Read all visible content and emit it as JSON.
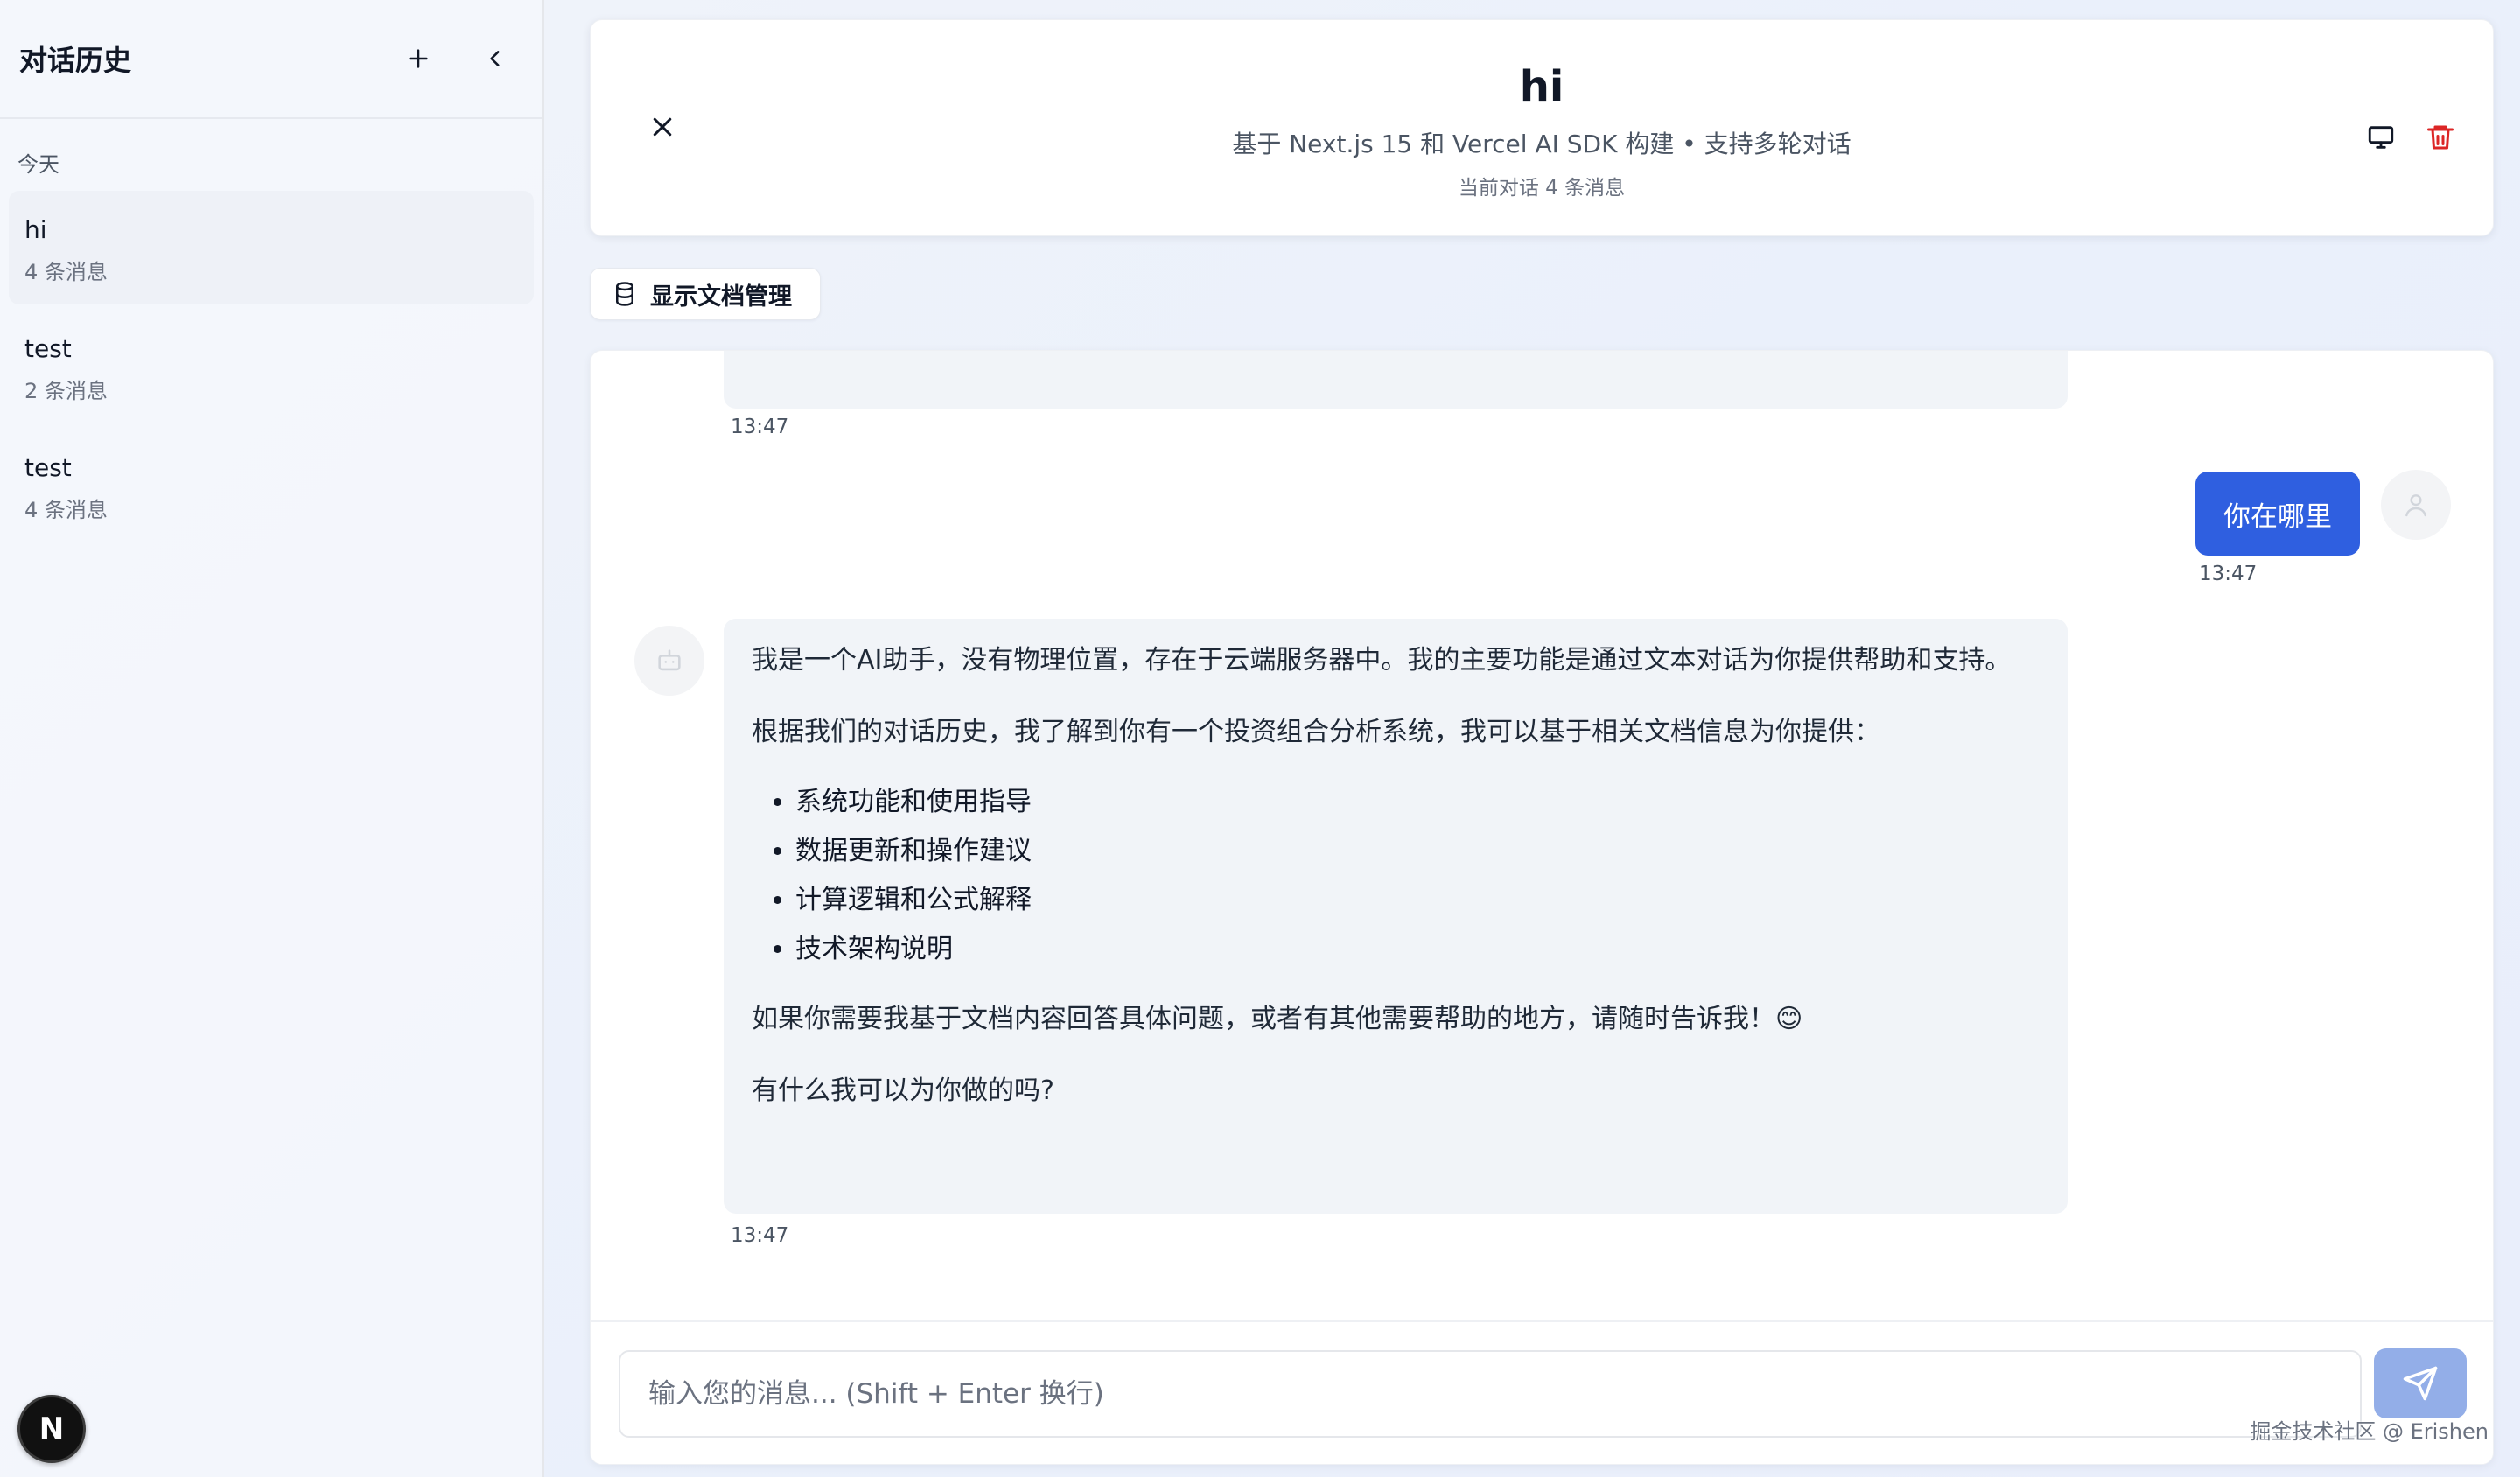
{
  "sidebar": {
    "title": "对话历史",
    "group_label": "今天",
    "items": [
      {
        "title": "hi",
        "meta": "4 条消息"
      },
      {
        "title": "test",
        "meta": "2 条消息"
      },
      {
        "title": "test",
        "meta": "4 条消息"
      }
    ],
    "badge_letter": "N"
  },
  "header": {
    "title": "hi",
    "subtitle": "基于 Next.js 15 和 Vercel AI SDK 构建 • 支持多轮对话",
    "count": "当前对话 4 条消息"
  },
  "doc_toggle": {
    "label": "显示文档管理"
  },
  "messages": {
    "prev_time": "13:47",
    "user": {
      "text": "你在哪里",
      "time": "13:47"
    },
    "bot": {
      "p1": "我是一个AI助手，没有物理位置，存在于云端服务器中。我的主要功能是通过文本对话为你提供帮助和支持。",
      "p2": "根据我们的对话历史，我了解到你有一个投资组合分析系统，我可以基于相关文档信息为你提供：",
      "list": [
        "系统功能和使用指导",
        "数据更新和操作建议",
        "计算逻辑和公式解释",
        "技术架构说明"
      ],
      "p3": "如果你需要我基于文档内容回答具体问题，或者有其他需要帮助的地方，请随时告诉我！😊",
      "p4": "有什么我可以为你做的吗?",
      "time": "13:47"
    }
  },
  "composer": {
    "placeholder": "输入您的消息... (Shift + Enter 换行)"
  },
  "watermark": "掘金技术社区 @ Erishen",
  "colors": {
    "accent": "#2f5fe0",
    "send_disabled": "#93aee8",
    "danger": "#dc2626"
  }
}
